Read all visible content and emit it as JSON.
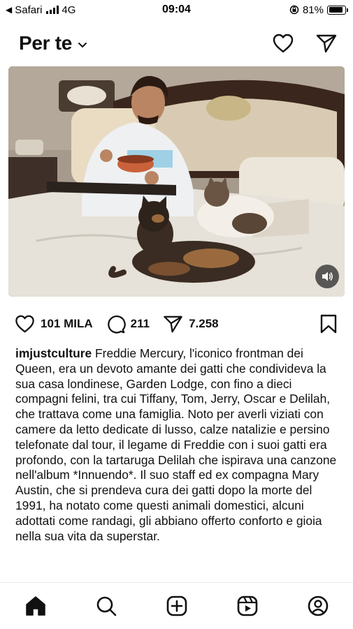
{
  "status_bar": {
    "back_app": "Safari",
    "network": "4G",
    "time": "09:04",
    "battery": "81%"
  },
  "header": {
    "title": "Per te",
    "icons": [
      "chevron-down-icon",
      "heart-icon",
      "send-icon"
    ]
  },
  "post": {
    "media_controls": [
      "volume-icon"
    ],
    "likes": "101 MILA",
    "comments": "211",
    "shares": "7.258",
    "username": "imjustculture",
    "caption": "Freddie Mercury, l'iconico frontman dei Queen, era un devoto amante dei gatti che condivideva la sua casa londinese, Garden Lodge, con fino a dieci compagni felini, tra cui Tiffany, Tom, Jerry, Oscar e Delilah, che trattava come una famiglia. Noto per averli viziati con camere da letto dedicate di lusso, calze natalizie e persino telefonate dal tour, il legame di Freddie con i suoi gatti era profondo, con la tartaruga Delilah che ispirava una canzone nell'album *Innuendo*. Il suo staff ed ex compagna Mary Austin, che si prendeva cura dei gatti dopo la morte del 1991, ha notato come questi animali domestici, alcuni adottati come randagi, gli abbiano offerto conforto e gioia nella sua vita da superstar."
  },
  "tab_bar": [
    "home-icon",
    "search-icon",
    "create-icon",
    "reels-icon",
    "profile-icon"
  ]
}
